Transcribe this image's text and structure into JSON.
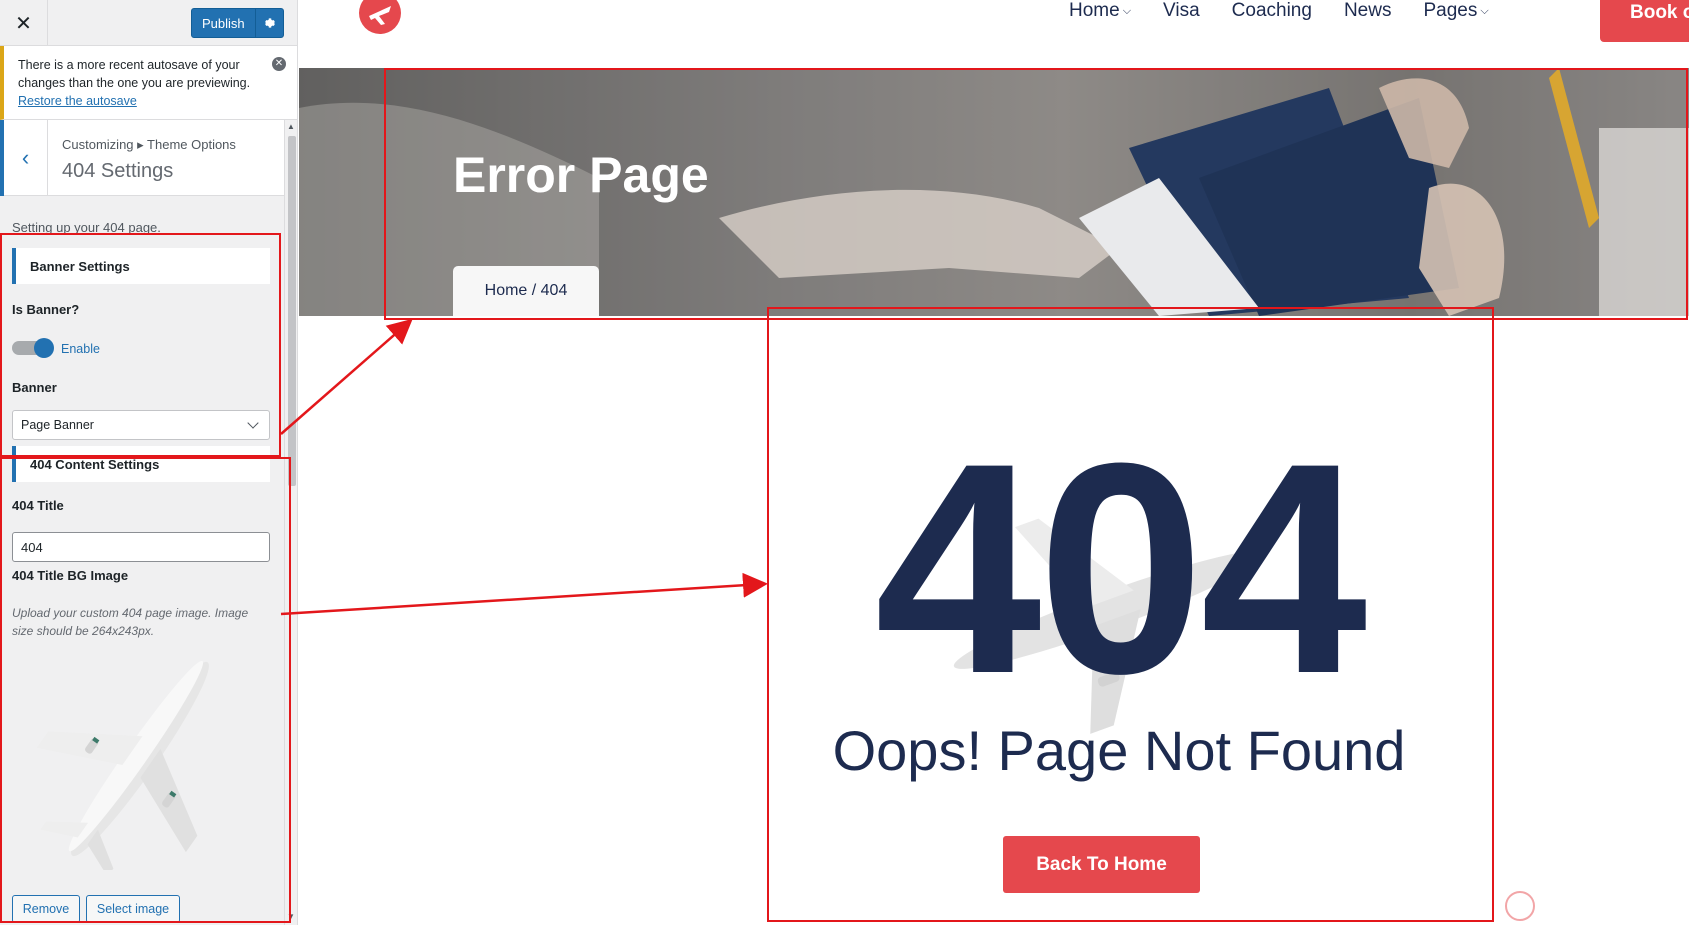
{
  "customizer": {
    "close_label": "✕",
    "publish_label": "Publish",
    "notice": {
      "text": "There is a more recent autosave of your changes than the one you are previewing.",
      "link": "Restore the autosave"
    },
    "breadcrumb": "Customizing ▸ Theme Options",
    "section_title": "404 Settings",
    "description": "Setting up your 404 page.",
    "banner_group": {
      "heading": "Banner Settings",
      "is_banner_label": "Is Banner?",
      "toggle_label": "Enable",
      "toggle_on": true,
      "banner_label": "Banner",
      "banner_value": "Page Banner"
    },
    "content_group": {
      "heading": "404 Content Settings",
      "title_label": "404 Title",
      "title_value": "404",
      "bg_image_label": "404 Title BG Image",
      "bg_image_help": "Upload your custom 404 page image. Image size should be 264x243px.",
      "remove_label": "Remove",
      "select_label": "Select image"
    }
  },
  "site": {
    "nav": [
      {
        "label": "Home",
        "dropdown": true
      },
      {
        "label": "Visa",
        "dropdown": false
      },
      {
        "label": "Coaching",
        "dropdown": false
      },
      {
        "label": "News",
        "dropdown": false
      },
      {
        "label": "Pages",
        "dropdown": true
      }
    ],
    "book_label": "Book o",
    "banner_title": "Error Page",
    "banner_breadcrumb": "Home / 404",
    "error_number": "404",
    "error_message": "Oops! Page Not Found",
    "back_home_label": "Back To Home"
  },
  "colors": {
    "wp_blue": "#2271b1",
    "accent_red": "#e5484d",
    "navy": "#1d2b4f",
    "annotation_red": "#e3171b"
  }
}
